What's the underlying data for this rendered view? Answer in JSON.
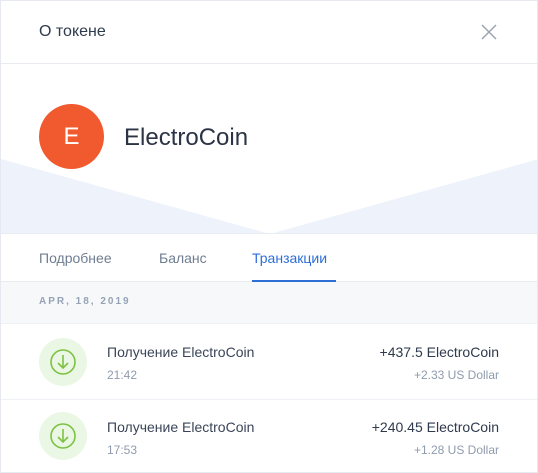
{
  "header": {
    "title": "О токене",
    "close_icon": "close-icon"
  },
  "token": {
    "letter": "E",
    "name": "ElectroCoin",
    "avatar_color": "#f05a2e"
  },
  "tabs": [
    {
      "label": "Подробнее",
      "active": false
    },
    {
      "label": "Баланс",
      "active": false
    },
    {
      "label": "Транзакции",
      "active": true
    }
  ],
  "transactions": {
    "date": "APR, 18, 2019",
    "items": [
      {
        "icon": "receive-arrow-icon",
        "title": "Получение ElectroCoin",
        "time": "21:42",
        "amount": "+437.5 ElectroCoin",
        "fiat": "+2.33 US Dollar"
      },
      {
        "icon": "receive-arrow-icon",
        "title": "Получение ElectroCoin",
        "time": "17:53",
        "amount": "+240.45 ElectroCoin",
        "fiat": "+1.28 US Dollar"
      }
    ]
  },
  "colors": {
    "accent": "#2d6fd6",
    "receive_green": "#7dc242",
    "hero_tint": "#eef2fa"
  }
}
